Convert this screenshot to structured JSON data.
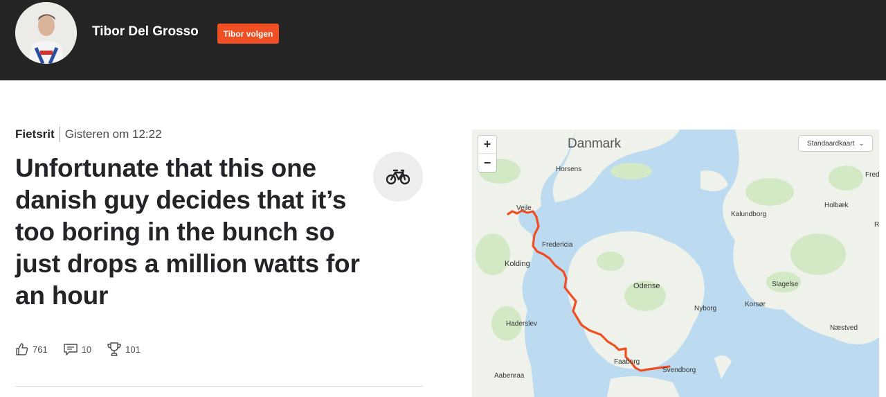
{
  "header": {
    "athlete_name": "Tibor Del Grosso",
    "follow_label": "Tibor volgen"
  },
  "activity": {
    "type": "Fietsrit",
    "time": "Gisteren om 12:22",
    "title": "Unfortunate that this one danish guy decides that it’s too boring in the bunch so just drops a million watts for an hour",
    "sport_icon": "bike-icon"
  },
  "stats": {
    "kudos": "761",
    "comments": "10",
    "achievements": "101"
  },
  "map": {
    "zoom_in": "+",
    "zoom_out": "−",
    "map_type": "Standaardkaart",
    "route_color": "#f04e23",
    "labels": {
      "country": "Danmark",
      "horsens": "Horsens",
      "vejle": "Vejle",
      "fredericia": "Fredericia",
      "kolding": "Kolding",
      "haderslev": "Haderslev",
      "aabenraa": "Aabenraa",
      "odense": "Odense",
      "nyborg": "Nyborg",
      "korsor": "Korsør",
      "slagelse": "Slagelse",
      "kalundborg": "Kalundborg",
      "holbaek": "Holbæk",
      "naestved": "Næstved",
      "faaborg": "Faaborg",
      "svendborg": "Svendborg",
      "fred_cut": "Fred",
      "r_cut": "R"
    }
  },
  "colors": {
    "header_bg": "#242424",
    "accent": "#f04e23"
  }
}
